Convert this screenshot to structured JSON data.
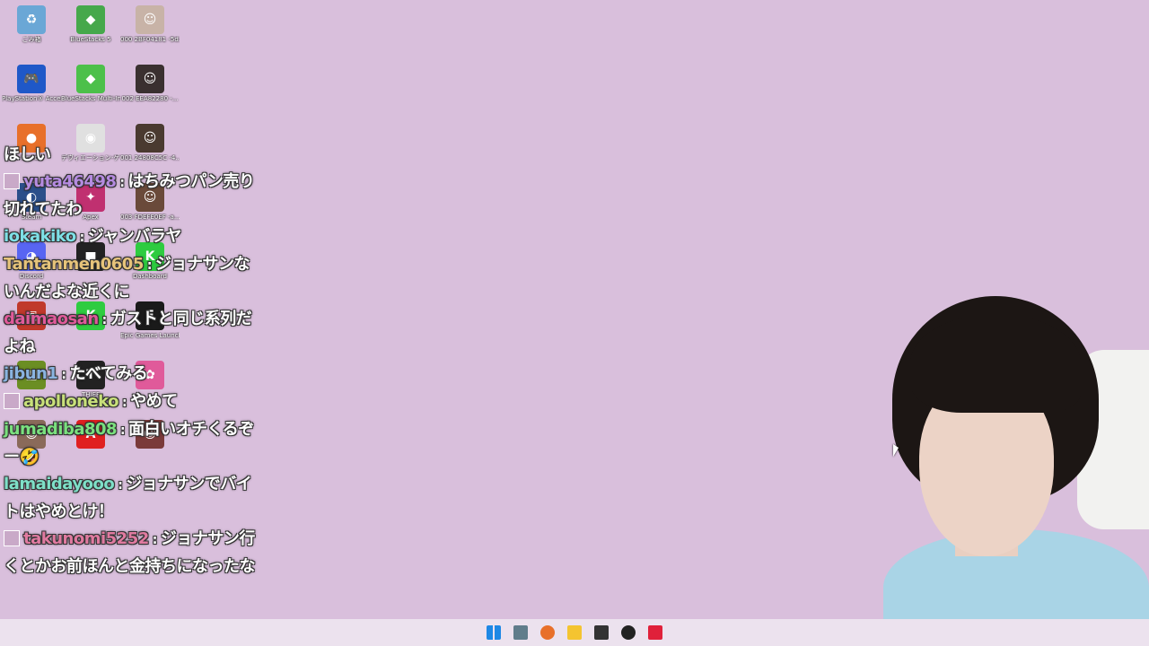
{
  "desktop": {
    "icons": [
      {
        "label": "ごみ箱",
        "glyph": "♻",
        "color": "#6aa7d6"
      },
      {
        "label": "BlueStacks 5",
        "glyph": "◆",
        "color": "#46a84b"
      },
      {
        "label": "000 2BF04181 -5d...",
        "glyph": "☺",
        "color": "#c8b3a7"
      },
      {
        "label": "PlayStation® Accessories",
        "glyph": "🎮",
        "color": "#1f58c8"
      },
      {
        "label": "BlueStacks Multi-Instan...",
        "glyph": "◆",
        "color": "#4cc04a"
      },
      {
        "label": "002 EEA82280 -...",
        "glyph": "☺",
        "color": "#3a3030"
      },
      {
        "label": "Firefox",
        "glyph": "●",
        "color": "#e8702a"
      },
      {
        "label": "デヴィエーション-ゲーム",
        "glyph": "◉",
        "color": "#e0e0e0"
      },
      {
        "label": "001 24808C5C -4...",
        "glyph": "☺",
        "color": "#4a3a30"
      },
      {
        "label": "Steam",
        "glyph": "◐",
        "color": "#2b4f8a"
      },
      {
        "label": "Apex",
        "glyph": "✦",
        "color": "#c03070"
      },
      {
        "label": "003 FDEFE0EF -a...",
        "glyph": "☺",
        "color": "#6a4a3a"
      },
      {
        "label": "Discord",
        "glyph": "◕",
        "color": "#5865f2"
      },
      {
        "label": "",
        "glyph": "■",
        "color": "#222222"
      },
      {
        "label": "Dashboard",
        "glyph": "K",
        "color": "#2ecc40"
      },
      {
        "label": "",
        "glyph": "▣",
        "color": "#c0392b"
      },
      {
        "label": "",
        "glyph": "K",
        "color": "#2ecc40"
      },
      {
        "label": "Epic Games Launcher",
        "glyph": "E",
        "color": "#1a1a1a"
      },
      {
        "label": "",
        "glyph": "▦",
        "color": "#6b8e23"
      },
      {
        "label": "THIEF",
        "glyph": "T",
        "color": "#222222"
      },
      {
        "label": "",
        "glyph": "✿",
        "color": "#e05a9a"
      },
      {
        "label": "",
        "glyph": "☺",
        "color": "#8a6a5a"
      },
      {
        "label": "",
        "glyph": "A",
        "color": "#e02020"
      },
      {
        "label": "",
        "glyph": "☺",
        "color": "#7a3a3a"
      }
    ]
  },
  "chat": {
    "messages": [
      {
        "user": "",
        "user_color": "#ffffff",
        "text": "ほしい",
        "avatar": false
      },
      {
        "user": "yuta46498",
        "user_color": "#b58be0",
        "text": "はちみつパン売り切れてたわ",
        "avatar": true
      },
      {
        "user": "iokakiko",
        "user_color": "#7ee0e6",
        "text": "ジャンバラヤ",
        "avatar": false
      },
      {
        "user": "Tantanmen0605",
        "user_color": "#e6c37a",
        "text": "ジョナサンないんだよな近くに",
        "avatar": false
      },
      {
        "user": "daimaosan",
        "user_color": "#e05a9a",
        "text": "ガストと同じ系列だよね",
        "avatar": false
      },
      {
        "user": "jibun1",
        "user_color": "#8ab4e0",
        "text": "たべてみる",
        "avatar": false
      },
      {
        "user": "apolloneko",
        "user_color": "#c8e07a",
        "text": "やめて",
        "avatar": true
      },
      {
        "user": "jumadiba808",
        "user_color": "#7ae07e",
        "text": "面白いオチくるぞー🤣",
        "avatar": false
      },
      {
        "user": "lamaidayooo",
        "user_color": "#7ee0c8",
        "text": "ジョナサンでバイトはやめとけ！",
        "avatar": false
      },
      {
        "user": "takunomi5252",
        "user_color": "#e07aa0",
        "text": "ジョナサン行くとかお前ほんと金持ちになったな",
        "avatar": true
      }
    ]
  },
  "taskbar": {
    "items": [
      {
        "name": "start-icon",
        "color": "#1e88e5"
      },
      {
        "name": "settings-icon",
        "color": "#607d8b"
      },
      {
        "name": "firefox-icon",
        "color": "#e8702a"
      },
      {
        "name": "file-explorer-icon",
        "color": "#f4c430"
      },
      {
        "name": "app-icon",
        "color": "#333333"
      },
      {
        "name": "obs-icon",
        "color": "#222222"
      },
      {
        "name": "app-red-icon",
        "color": "#e0203a"
      }
    ]
  }
}
